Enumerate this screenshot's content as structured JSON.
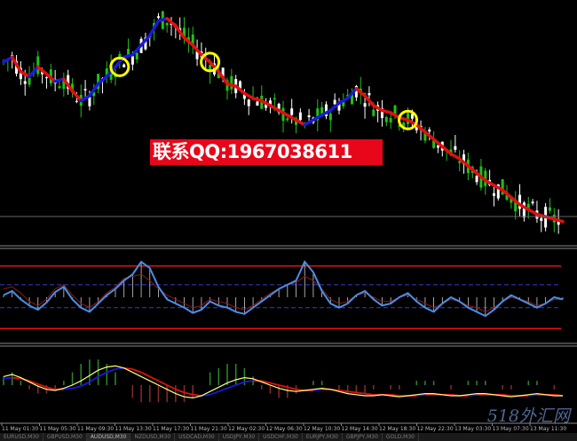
{
  "contact_banner": "联系QQ:1967038611",
  "watermark": "518外汇网",
  "time_axis_labels": [
    "11 May 01:30",
    "11 May 05:30",
    "11 May 09:30",
    "11 May 13:30",
    "11 May 17:30",
    "11 May 21:30",
    "12 May 02:30",
    "12 May 06:30",
    "12 May 10:30",
    "12 May 14:30",
    "12 May 18:30",
    "12 May 22:30",
    "13 May 03:30",
    "13 May 07:30",
    "13 May 11:30"
  ],
  "tabs": [
    {
      "label": "EURUSD,M30",
      "active": false
    },
    {
      "label": "GBPUSD,M30",
      "active": false
    },
    {
      "label": "AUDUSD,M30",
      "active": true
    },
    {
      "label": "NZDUSD,M30",
      "active": false
    },
    {
      "label": "USDCAD,M30",
      "active": false
    },
    {
      "label": "USDJPY,M30",
      "active": false
    },
    {
      "label": "USDCHF,M30",
      "active": false
    },
    {
      "label": "EURJPY,M30",
      "active": false
    },
    {
      "label": "GBPJPY,M30",
      "active": false
    },
    {
      "label": "GOLD,M30",
      "active": false
    }
  ],
  "colors": {
    "background": "#000000",
    "bull_candle": "#22c016",
    "bear_candle": "#ffffff",
    "trend_down": "#e01010",
    "trend_up": "#1a1ad8",
    "highlight_circle": "#ffff00",
    "level_line": "#e01010",
    "oscillator_main": "#4a8ee8",
    "oscillator_signal": "#8b1a1a",
    "oscillator_dash": "#3a3ad0",
    "macd_fast": "#ffff80",
    "macd_slow_up": "#1a1ad8",
    "macd_slow_down": "#e01010",
    "histogram_pos": "#2a8a2a",
    "histogram_neg": "#8b2a2a",
    "separator": "#888888"
  },
  "chart_data": [
    {
      "type": "candlestick",
      "title": "AUDUSD,M30",
      "x": [
        0,
        2,
        4,
        6,
        8,
        10,
        12,
        14,
        16,
        18,
        20,
        22,
        24,
        26,
        28,
        30,
        32,
        34,
        36,
        38,
        40,
        42,
        44,
        46,
        48,
        50,
        52,
        54,
        56,
        58,
        60,
        62,
        64,
        66,
        68,
        70,
        72,
        74,
        76,
        78,
        80,
        82,
        84,
        86,
        88,
        90,
        92,
        94,
        96,
        98,
        100,
        102,
        104,
        106,
        108,
        110,
        112,
        114,
        116,
        118,
        120,
        122,
        124,
        126,
        128,
        130
      ],
      "close": [
        3.0,
        3.2,
        2.6,
        2.4,
        2.8,
        2.5,
        2.2,
        2.3,
        1.8,
        1.4,
        1.6,
        2.1,
        2.4,
        2.8,
        3.2,
        3.3,
        3.7,
        4.1,
        4.7,
        4.8,
        4.5,
        4.0,
        3.7,
        3.3,
        3.0,
        2.6,
        2.1,
        2.0,
        1.7,
        1.5,
        1.4,
        1.2,
        1.0,
        0.8,
        0.6,
        0.4,
        0.6,
        0.8,
        1.0,
        1.3,
        1.5,
        1.9,
        1.6,
        1.2,
        1.0,
        0.9,
        0.7,
        0.6,
        0.4,
        0.1,
        -0.2,
        -0.5,
        -0.8,
        -1.0,
        -1.3,
        -1.6,
        -1.9,
        -2.1,
        -2.3,
        -2.6,
        -2.9,
        -3.1,
        -3.3,
        -3.4,
        -3.5,
        -3.6
      ],
      "markers_at_x": [
        27,
        48,
        94
      ],
      "ylim": [
        -4.2,
        5.2
      ]
    },
    {
      "type": "line",
      "subtype": "oscillator",
      "levels": {
        "upper": 80,
        "lower": 20,
        "dash_upper": 62,
        "dash_lower": 40
      },
      "ylim": [
        10,
        90
      ],
      "series": [
        {
          "values": [
            52,
            56,
            48,
            42,
            38,
            45,
            55,
            60,
            48,
            40,
            36,
            44,
            52,
            58,
            66,
            72,
            84,
            78,
            60,
            48,
            44,
            40,
            35,
            38,
            46,
            42,
            40,
            36,
            34,
            40,
            46,
            52,
            58,
            62,
            66,
            84,
            74,
            56,
            44,
            40,
            44,
            52,
            56,
            48,
            42,
            44,
            50,
            54,
            46,
            40,
            36,
            44,
            50,
            46,
            40,
            36,
            32,
            38,
            46,
            52,
            48,
            44,
            40,
            44,
            50,
            48
          ]
        },
        {
          "values": [
            58,
            60,
            54,
            46,
            42,
            48,
            58,
            62,
            52,
            44,
            40,
            46,
            54,
            60,
            68,
            70,
            72,
            66,
            58,
            52,
            48,
            44,
            40,
            42,
            48,
            46,
            44,
            40,
            38,
            42,
            48,
            54,
            58,
            62,
            64,
            70,
            66,
            58,
            48,
            44,
            46,
            52,
            54,
            50,
            46,
            46,
            50,
            52,
            48,
            44,
            40,
            44,
            48,
            46,
            42,
            40,
            36,
            40,
            46,
            50,
            48,
            46,
            42,
            44,
            48,
            48
          ]
        }
      ]
    },
    {
      "type": "line",
      "subtype": "macd",
      "ylim": [
        -3,
        3
      ],
      "series": [
        {
          "values": [
            0.8,
            1.0,
            0.7,
            0.3,
            -0.1,
            -0.4,
            -0.5,
            -0.3,
            0.0,
            0.4,
            0.9,
            1.4,
            1.7,
            1.8,
            1.6,
            1.2,
            0.8,
            0.4,
            0.0,
            -0.4,
            -0.8,
            -1.1,
            -1.2,
            -1.0,
            -0.6,
            -0.2,
            0.2,
            0.5,
            0.7,
            0.6,
            0.3,
            0.0,
            -0.3,
            -0.5,
            -0.6,
            -0.5,
            -0.4,
            -0.3,
            -0.4,
            -0.6,
            -0.8,
            -0.9,
            -1.0,
            -1.0,
            -0.9,
            -1.0,
            -1.1,
            -1.0,
            -0.9,
            -0.8,
            -0.8,
            -0.9,
            -1.0,
            -1.0,
            -0.9,
            -0.8,
            -0.8,
            -0.9,
            -1.0,
            -1.1,
            -1.0,
            -0.9,
            -0.8,
            -0.9,
            -1.0,
            -1.0
          ]
        },
        {
          "values": [
            0.6,
            0.7,
            0.6,
            0.4,
            0.1,
            -0.2,
            -0.4,
            -0.4,
            -0.3,
            -0.1,
            0.3,
            0.8,
            1.2,
            1.5,
            1.6,
            1.5,
            1.2,
            0.8,
            0.4,
            0.0,
            -0.4,
            -0.7,
            -0.9,
            -1.0,
            -0.9,
            -0.6,
            -0.3,
            0.0,
            0.3,
            0.4,
            0.4,
            0.2,
            0.0,
            -0.2,
            -0.4,
            -0.5,
            -0.5,
            -0.4,
            -0.4,
            -0.5,
            -0.6,
            -0.7,
            -0.8,
            -0.9,
            -0.9,
            -0.9,
            -1.0,
            -1.0,
            -1.0,
            -0.9,
            -0.9,
            -0.9,
            -0.9,
            -1.0,
            -1.0,
            -0.9,
            -0.9,
            -0.9,
            -0.9,
            -1.0,
            -1.0,
            -1.0,
            -0.9,
            -0.9,
            -0.9,
            -1.0
          ]
        }
      ]
    }
  ]
}
